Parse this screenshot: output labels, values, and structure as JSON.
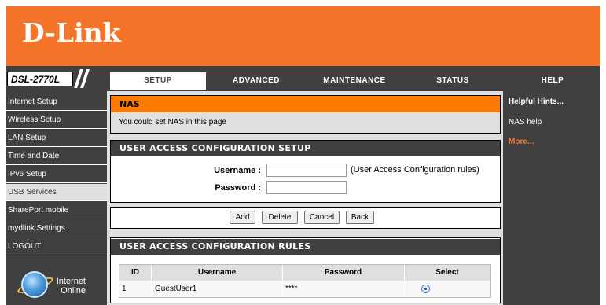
{
  "brand": {
    "logo_text": "D-Link",
    "model": "DSL-2770L"
  },
  "tabs": [
    {
      "label": "SETUP",
      "active": true
    },
    {
      "label": "ADVANCED",
      "active": false
    },
    {
      "label": "MAINTENANCE",
      "active": false
    },
    {
      "label": "STATUS",
      "active": false
    },
    {
      "label": "HELP",
      "active": false
    }
  ],
  "sidebar": {
    "items": [
      {
        "label": "Internet Setup",
        "active": false
      },
      {
        "label": "Wireless Setup",
        "active": false
      },
      {
        "label": "LAN Setup",
        "active": false
      },
      {
        "label": "Time and Date",
        "active": false
      },
      {
        "label": "IPv6 Setup",
        "active": false
      },
      {
        "label": "USB Services",
        "active": true
      },
      {
        "label": "SharePort mobile",
        "active": false
      },
      {
        "label": "mydlink Settings",
        "active": false
      },
      {
        "label": "LOGOUT",
        "active": false
      }
    ],
    "status": {
      "line1": "Internet",
      "line2": "Online",
      "icon": "globe-icon"
    }
  },
  "main": {
    "nas": {
      "title": "NAS",
      "description": "You could set NAS in this page"
    },
    "setup": {
      "title": "USER ACCESS CONFIGURATION SETUP",
      "username_label": "Username :",
      "username_value": "",
      "password_label": "Password :",
      "password_value": "",
      "note": "(User Access Configuration rules)"
    },
    "buttons": {
      "add": "Add",
      "delete": "Delete",
      "cancel": "Cancel",
      "back": "Back"
    },
    "rules": {
      "title": "USER ACCESS CONFIGURATION RULES",
      "columns": [
        "ID",
        "Username",
        "Password",
        "Select"
      ],
      "rows": [
        {
          "id": "1",
          "username": "GuestUser1",
          "password": "****",
          "selected": true
        }
      ]
    }
  },
  "help": {
    "title": "Helpful Hints...",
    "link": "NAS help",
    "more": "More..."
  },
  "colors": {
    "brand_orange": "#f4742a",
    "section_orange": "#ff7a00",
    "dark_gray": "#404040",
    "light_gray": "#dfdfdf"
  }
}
